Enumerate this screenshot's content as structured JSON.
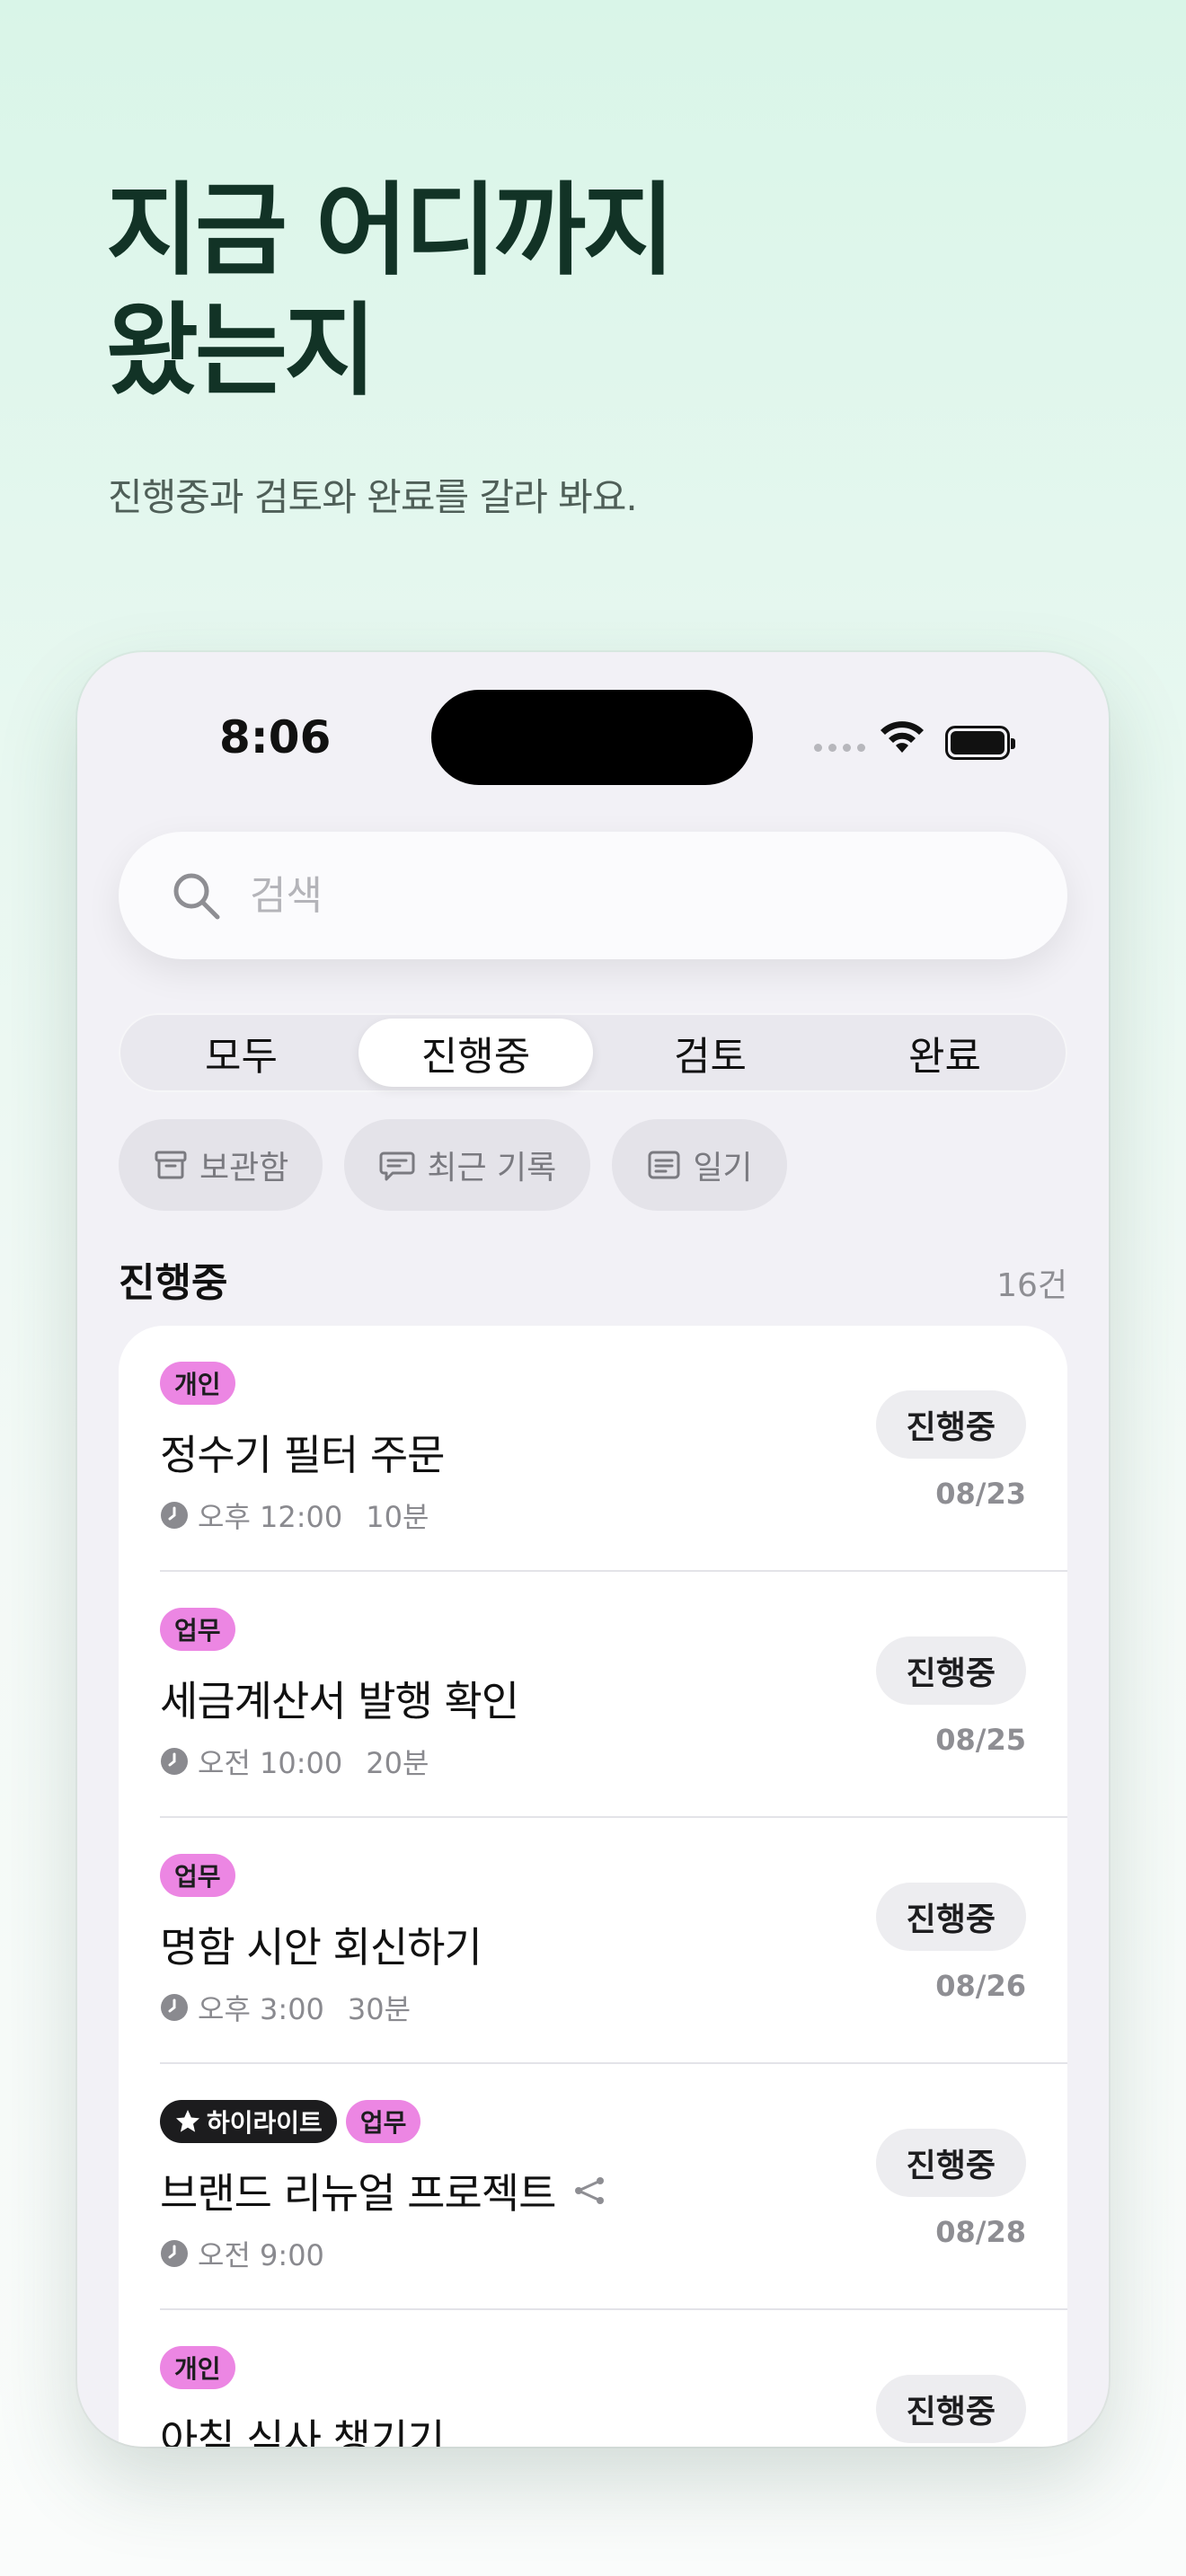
{
  "headline": {
    "line1": "지금 어디까지",
    "line2": "왔는지"
  },
  "subtitle": "진행중과 검토와 완료를 갈라 봐요.",
  "status_bar": {
    "time": "8:06"
  },
  "search": {
    "placeholder": "검색"
  },
  "segments": [
    {
      "label": "모두",
      "active": false
    },
    {
      "label": "진행중",
      "active": true
    },
    {
      "label": "검토",
      "active": false
    },
    {
      "label": "완료",
      "active": false
    }
  ],
  "chips": [
    {
      "label": "보관함",
      "icon": "archive-icon"
    },
    {
      "label": "최근 기록",
      "icon": "chat-bubble-icon"
    },
    {
      "label": "일기",
      "icon": "note-icon"
    }
  ],
  "section": {
    "title": "진행중",
    "count": "16건"
  },
  "tasks": [
    {
      "tags": [
        "개인"
      ],
      "highlight": "",
      "title": "정수기 필터 주문",
      "time": "오후 12:00",
      "duration": "10분",
      "status": "진행중",
      "date": "08/23",
      "shared": false
    },
    {
      "tags": [
        "업무"
      ],
      "highlight": "",
      "title": "세금계산서 발행 확인",
      "time": "오전 10:00",
      "duration": "20분",
      "status": "진행중",
      "date": "08/25",
      "shared": false
    },
    {
      "tags": [
        "업무"
      ],
      "highlight": "",
      "title": "명함 시안 회신하기",
      "time": "오후 3:00",
      "duration": "30분",
      "status": "진행중",
      "date": "08/26",
      "shared": false
    },
    {
      "tags": [
        "업무"
      ],
      "highlight": "하이라이트",
      "title": "브랜드 리뉴얼 프로젝트",
      "time": "오전 9:00",
      "duration": "",
      "status": "진행중",
      "date": "08/28",
      "shared": true
    },
    {
      "tags": [
        "개인"
      ],
      "highlight": "",
      "title": "아침 식사 챙기기",
      "time": "",
      "duration": "",
      "status": "진행중",
      "date": "",
      "shared": false
    }
  ],
  "colors": {
    "accent_tag": "#ec86e3",
    "headline": "#123326",
    "background": "#d9f5e8"
  }
}
